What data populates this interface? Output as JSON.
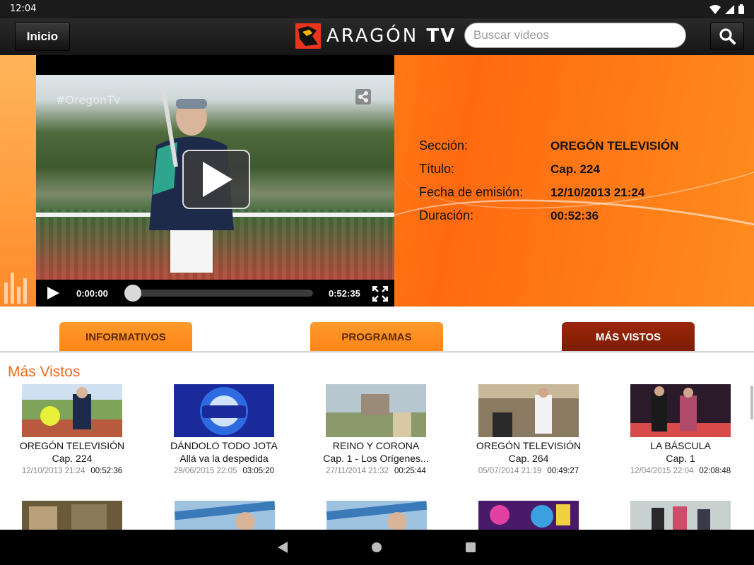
{
  "status_bar": {
    "time": "12:04"
  },
  "header": {
    "home_label": "Inicio",
    "logo_text_a": "ARAGÓN",
    "logo_text_b": "TV",
    "search_placeholder": "Buscar videos"
  },
  "player": {
    "watermark": "#OregonTv",
    "current_time": "0:00:00",
    "duration": "0:52:35",
    "progress": 0
  },
  "details": {
    "seccion_label": "Sección:",
    "seccion_value": "OREGÓN TELEVISIÓN",
    "titulo_label": "Título:",
    "titulo_value": "Cap. 224",
    "fecha_label": "Fecha de emisión:",
    "fecha_value": "12/10/2013 21:24",
    "duracion_label": "Duración:",
    "duracion_value": "00:52:36"
  },
  "tabs": [
    {
      "label": "INFORMATIVOS",
      "active": false
    },
    {
      "label": "PROGRAMAS",
      "active": false
    },
    {
      "label": "MÁS VISTOS",
      "active": true
    }
  ],
  "section_title": "Más Vistos",
  "videos": [
    {
      "title": "OREGÓN TELEVISIÓN",
      "subtitle": "Cap. 224",
      "date": "12/10/2013 21:24",
      "duration": "00:52:36"
    },
    {
      "title": "DÁNDOLO TODO JOTA",
      "subtitle": "Allá va la despedida",
      "date": "29/06/2015 22:05",
      "duration": "03:05:20"
    },
    {
      "title": "REINO Y CORONA",
      "subtitle": "Cap. 1 - Los Orígenes...",
      "date": "27/11/2014 21:32",
      "duration": "00:25:44"
    },
    {
      "title": "OREGÓN TELEVISIÓN",
      "subtitle": "Cap. 264",
      "date": "05/07/2014 21:19",
      "duration": "00:49:27"
    },
    {
      "title": "LA BÁSCULA",
      "subtitle": "Cap. 1",
      "date": "12/04/2015 22:04",
      "duration": "02:08:48"
    }
  ],
  "colors": {
    "accent": "#f26a1b",
    "tab_orange": "#ff8c1e",
    "tab_active": "#8b2106",
    "top_bar": "#1c1c1c"
  }
}
